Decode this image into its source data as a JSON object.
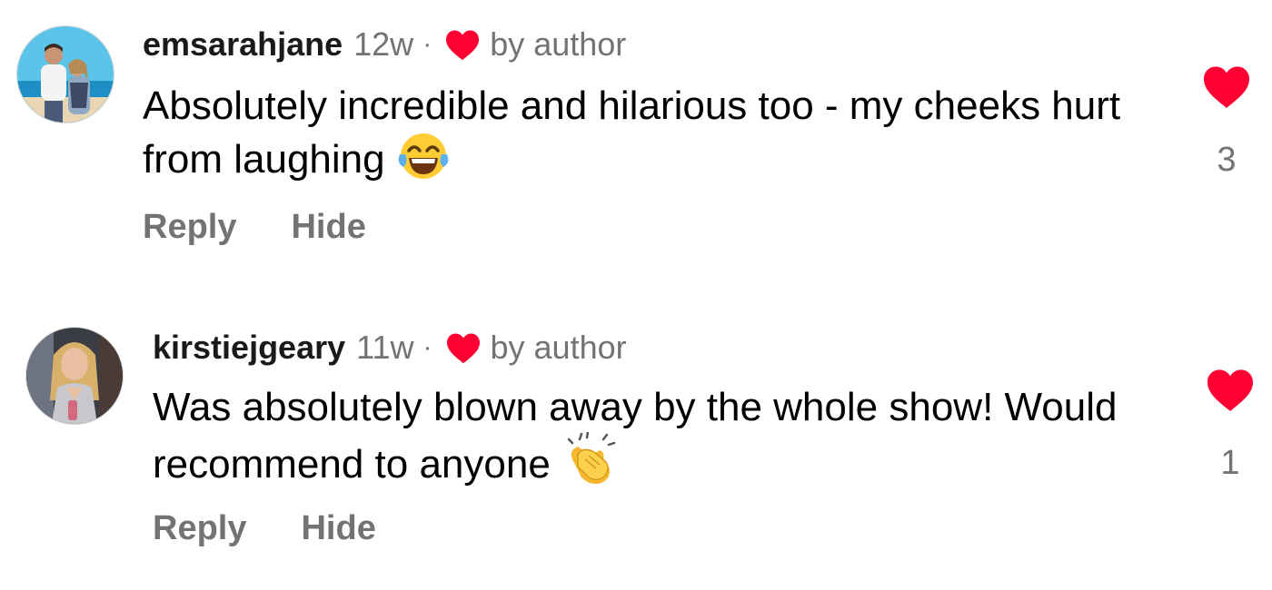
{
  "colors": {
    "heart": "#ff0033",
    "muted": "#737373",
    "text": "#000000"
  },
  "comments": [
    {
      "username": "emsarahjane",
      "time": "12w",
      "separator": "·",
      "liked_label": "by author",
      "liked_icon": "heart-icon",
      "text": "Absolutely incredible and hilarious too - my cheeks hurt from laughing",
      "emoji": "face-with-tears-of-joy",
      "reply_label": "Reply",
      "hide_label": "Hide",
      "like_count": "3"
    },
    {
      "username": "kirstiejgeary",
      "time": "11w",
      "separator": "·",
      "liked_label": "by author",
      "liked_icon": "heart-icon",
      "text": "Was absolutely blown away by the whole show! Would recommend to anyone",
      "emoji": "clapping-hands",
      "reply_label": "Reply",
      "hide_label": "Hide",
      "like_count": "1"
    }
  ]
}
